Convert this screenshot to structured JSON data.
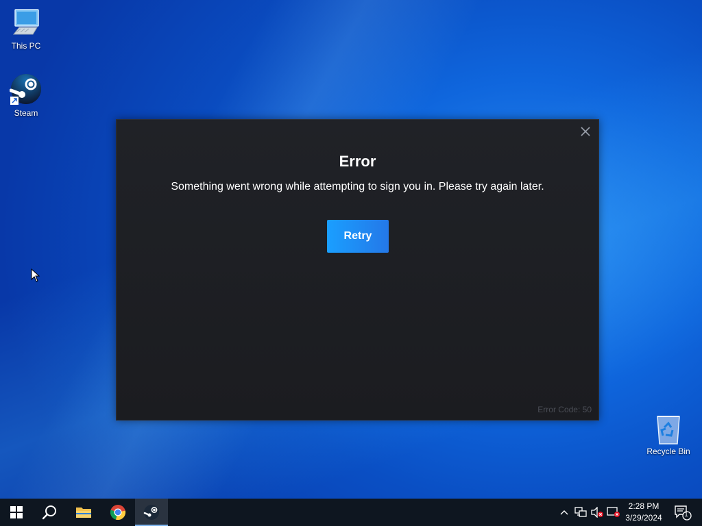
{
  "desktop": {
    "icons": [
      {
        "label": "This PC",
        "icon": "this-pc-icon"
      },
      {
        "label": "Steam",
        "icon": "steam-icon"
      },
      {
        "label": "Recycle Bin",
        "icon": "recycle-bin-icon"
      }
    ]
  },
  "dialog": {
    "title": "Error",
    "message": "Something went wrong while attempting to sign you in. Please try again later.",
    "retry_label": "Retry",
    "error_code": "Error Code: 50",
    "close_icon": "close-icon",
    "colors": {
      "background": "#1e2024",
      "button": "#1a9fff"
    }
  },
  "taskbar": {
    "apps": [
      {
        "name": "Start",
        "icon": "windows-start-icon"
      },
      {
        "name": "Search",
        "icon": "search-icon"
      },
      {
        "name": "File Explorer",
        "icon": "folder-icon"
      },
      {
        "name": "Google Chrome",
        "icon": "chrome-icon"
      },
      {
        "name": "Steam",
        "icon": "steam-icon",
        "active": true
      }
    ],
    "tray_icons": [
      "chevron-up-icon",
      "network-icon",
      "volume-muted-icon",
      "display-icon"
    ],
    "time": "2:28 PM",
    "date": "3/29/2024",
    "notification_count": "1"
  }
}
